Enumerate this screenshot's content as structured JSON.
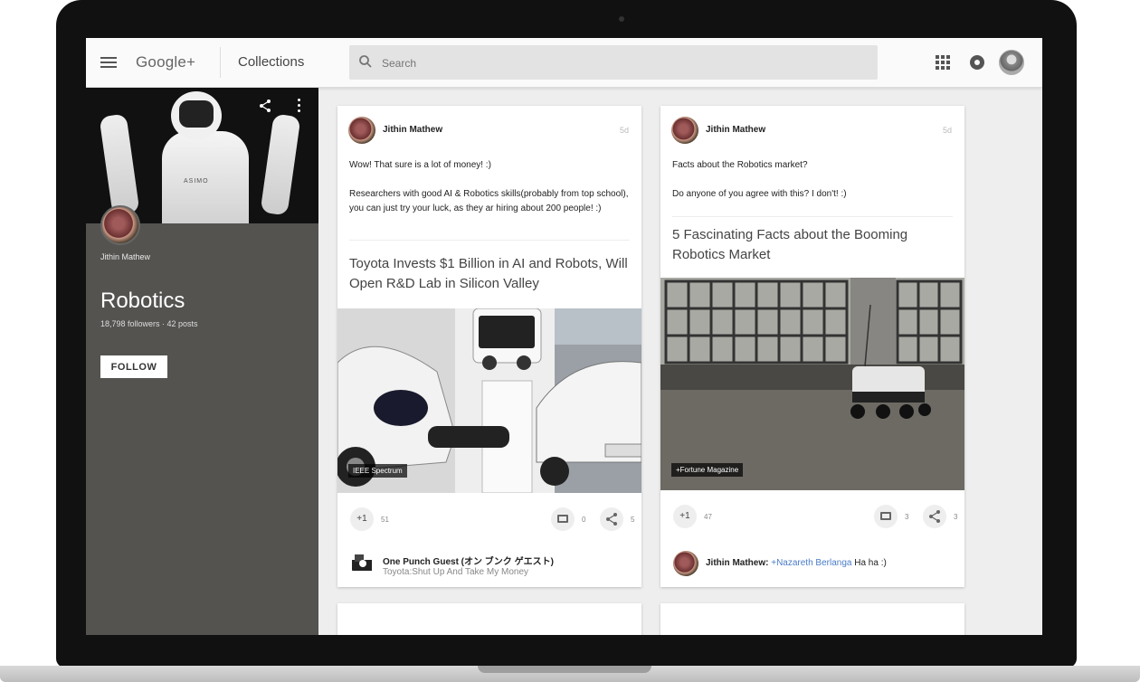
{
  "header": {
    "logo": "Google+",
    "section_title": "Collections",
    "search_placeholder": "Search"
  },
  "collection": {
    "owner_name": "Jithin Mathew",
    "title": "Robotics",
    "stats": "18,798 followers · 42 posts",
    "follow_label": "FOLLOW",
    "cover_robot_label": "ASIMO"
  },
  "posts": [
    {
      "author": "Jithin Mathew",
      "timestamp": "5d",
      "text": "Wow! That sure is a lot of money! :)\n\nResearchers with good AI & Robotics skills(probably from top school), you can just try your luck, as they ar hiring about 200 people! :)",
      "link_title": "Toyota Invests $1 Billion in AI and Robots, Will Open R&D Lab in Silicon Valley",
      "source": "IEEE Spectrum",
      "plus_label": "+1",
      "plus_count": "51",
      "comment_count": "0",
      "share_count": "5",
      "top_comment_author": "One Punch Guest (オン ブンク ゲエスト)",
      "top_comment_text": "Toyota:Shut Up And Take My Money"
    },
    {
      "author": "Jithin Mathew",
      "timestamp": "5d",
      "text": "Facts about the Robotics market?\n\nDo anyone of you agree with this? I don't! :)",
      "link_title": "5 Fascinating Facts about the Booming Robotics Market",
      "source": "+Fortune Magazine",
      "plus_label": "+1",
      "plus_count": "47",
      "comment_count": "3",
      "share_count": "3",
      "top_comment_author": "Jithin Mathew:",
      "top_comment_mention": "+Nazareth Berlanga",
      "top_comment_text": "Ha ha :)"
    }
  ],
  "colors": {
    "sidebar": "#545350",
    "topbar": "#fafafa",
    "accent_link": "#4a7cc9"
  }
}
